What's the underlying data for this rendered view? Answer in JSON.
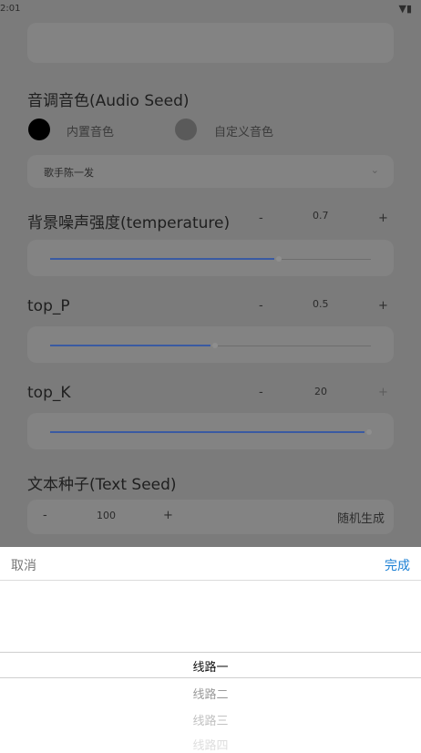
{
  "status": {
    "time": "2:01",
    "icons": "▼▮"
  },
  "audio_seed": {
    "title": "音调音色(Audio Seed)",
    "options": [
      "内置音色",
      "自定义音色"
    ],
    "selected_voice": "歌手陈一发",
    "chevron": "chevron-down-icon"
  },
  "temperature": {
    "label": "背景噪声强度(temperature)",
    "minus": "-",
    "value": "0.7",
    "plus": "+",
    "fraction": 0.7
  },
  "top_p": {
    "label": "top_P",
    "minus": "-",
    "value": "0.5",
    "plus": "+",
    "fraction": 0.5
  },
  "top_k": {
    "label": "top_K",
    "minus": "-",
    "value": "20",
    "plus": "+",
    "fraction": 0.98
  },
  "text_seed": {
    "title": "文本种子(Text Seed)",
    "minus": "-",
    "value": "100",
    "plus": "+",
    "random": "随机生成"
  },
  "sheet": {
    "cancel": "取消",
    "done": "完成",
    "options": [
      "线路一",
      "线路二",
      "线路三",
      "线路四"
    ]
  },
  "colors": {
    "accent": "#1a7fd4",
    "slider": "#3a5aa2"
  }
}
